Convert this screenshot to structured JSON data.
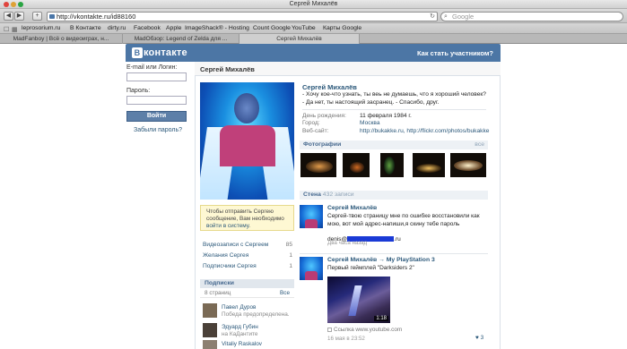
{
  "window": {
    "title": "Сергей Михалёв"
  },
  "toolbar": {
    "url": "http://vkontakte.ru/id88160",
    "search_placeholder": "Google"
  },
  "bookmarks": [
    "leprosorium.ru",
    "В Контакте",
    "dirty.ru",
    "Facebook",
    "Apple",
    "ImageShack® - Hosting",
    "Count Google",
    "YouTube",
    "Карты Google"
  ],
  "tabs": [
    "MadFanboy | Всё о видеоиграх, н...",
    "MadОбзор: Legend of Zelda для ...",
    "Сергей Михалёв"
  ],
  "vk": {
    "logo": "контакте",
    "logo_letter": "В",
    "join": "Как стать участником?"
  },
  "login": {
    "email_label": "E-mail или Логин:",
    "password_label": "Пароль:",
    "submit": "Войти",
    "forgot": "Забыли пароль?"
  },
  "profile": {
    "header": "Сергей Михалёв",
    "name": "Сергей Михалёв",
    "status": "- Хочу кое-что узнать, ты веь не думаешь, что я хороший человек? - Да нет, ты настоящий засранец. - Спасибо, друг.",
    "info": [
      {
        "key": "День рождения:",
        "value": "11 февраля 1984 г."
      },
      {
        "key": "Город:",
        "value": "Москва"
      },
      {
        "key": "Веб-сайт:",
        "value": "http://bukakke.ru, http://flickr.com/photos/bukakke"
      }
    ],
    "notice_pre": "Чтобы отправить Сергею сообщение, Вам необходимо ",
    "notice_link": "войти в систему",
    "notice_post": ".",
    "side_links": [
      {
        "label": "Видеозаписи с Сергеем",
        "count": "85"
      },
      {
        "label": "Желания Сергея",
        "count": "1"
      },
      {
        "label": "Подписчики Сергея",
        "count": "1"
      }
    ],
    "subs": {
      "title": "Подписки",
      "count": "8 страниц",
      "all": "Все",
      "items": [
        {
          "name": "Павел Дуров",
          "desc": "Победа предопределена."
        },
        {
          "name": "Эдуард Губин",
          "desc": "на КаДантите"
        },
        {
          "name": "Vitaliy Raskalov",
          "desc": ""
        }
      ]
    },
    "photos": {
      "title": "Фотографии",
      "all": "все"
    },
    "wall": {
      "title": "Стена",
      "count": "432 записи",
      "posts": [
        {
          "author": "Сергей Михалёв",
          "text": "Сергей-твою страницу мне по ошибке восстановили как мою, вот мой адрес-напиши,я скину тебе пароль",
          "email_pre": "denis@",
          "email_post": ".ru",
          "date": "Два часа назад"
        },
        {
          "author": "Сергей Михалёв → My PlayStation 3",
          "text": "Первый геймплей \"Darksiders 2\"",
          "duration": "1:18",
          "source": "Ссылка www.youtube.com",
          "date": "16 мая в 23:52",
          "likes": "3"
        }
      ]
    }
  }
}
